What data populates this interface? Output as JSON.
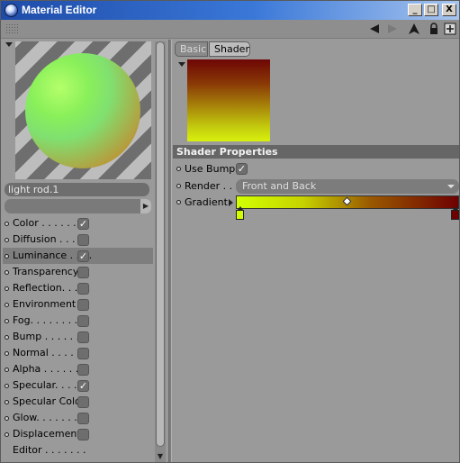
{
  "window": {
    "title": "Material Editor",
    "controls": {
      "minimize": "_",
      "maximize": "□",
      "close": "X"
    }
  },
  "toolbar": {
    "icons": [
      "grip-icon",
      "back-arrow-icon",
      "forward-arrow-icon",
      "up-arrow-icon",
      "lock-icon",
      "new-window-icon"
    ]
  },
  "material": {
    "name": "light rod.1"
  },
  "channels": [
    {
      "label": "Color . . . . . . .",
      "checked": true,
      "has_checkbox": true
    },
    {
      "label": "Diffusion . . . . .",
      "checked": false,
      "has_checkbox": true
    },
    {
      "label": "Luminance . . . .",
      "checked": true,
      "has_checkbox": true,
      "selected": true
    },
    {
      "label": "Transparency",
      "checked": false,
      "has_checkbox": true
    },
    {
      "label": "Reflection. . . . .",
      "checked": false,
      "has_checkbox": true
    },
    {
      "label": "Environment",
      "checked": false,
      "has_checkbox": true
    },
    {
      "label": "Fog. . . . . . . . .",
      "checked": false,
      "has_checkbox": true
    },
    {
      "label": "Bump . . . . . . .",
      "checked": false,
      "has_checkbox": true
    },
    {
      "label": "Normal . . . . . .",
      "checked": false,
      "has_checkbox": true
    },
    {
      "label": "Alpha . . . . . . .",
      "checked": false,
      "has_checkbox": true
    },
    {
      "label": "Specular. . . . .",
      "checked": true,
      "has_checkbox": true
    },
    {
      "label": "Specular Color",
      "checked": false,
      "has_checkbox": true
    },
    {
      "label": "Glow. . . . . . . .",
      "checked": false,
      "has_checkbox": true
    },
    {
      "label": "Displacement",
      "checked": false,
      "has_checkbox": true
    },
    {
      "label": "Editor . . . . . . .",
      "checked": false,
      "has_checkbox": false
    }
  ],
  "tabs": {
    "basic": "Basic",
    "shader": "Shader",
    "active": "Shader"
  },
  "shader_properties": {
    "header": "Shader Properties",
    "use_bump_label": "Use Bump",
    "use_bump_checked": true,
    "render_label": "Render . . .",
    "render_value": "Front and Back",
    "gradient_label": "Gradient",
    "gradient": {
      "knot_position": 0.5,
      "start_color": "#d2ff00",
      "end_color": "#6e0000"
    }
  },
  "check_glyph": "✓"
}
